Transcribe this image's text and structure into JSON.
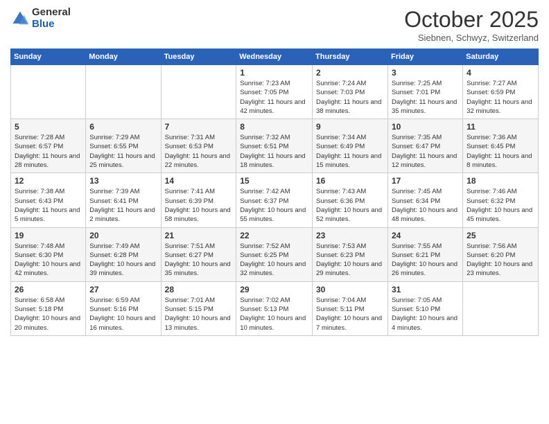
{
  "header": {
    "logo_general": "General",
    "logo_blue": "Blue",
    "month_title": "October 2025",
    "location": "Siebnen, Schwyz, Switzerland"
  },
  "days_of_week": [
    "Sunday",
    "Monday",
    "Tuesday",
    "Wednesday",
    "Thursday",
    "Friday",
    "Saturday"
  ],
  "weeks": [
    [
      {
        "day": "",
        "info": ""
      },
      {
        "day": "",
        "info": ""
      },
      {
        "day": "",
        "info": ""
      },
      {
        "day": "1",
        "info": "Sunrise: 7:23 AM\nSunset: 7:05 PM\nDaylight: 11 hours and 42 minutes."
      },
      {
        "day": "2",
        "info": "Sunrise: 7:24 AM\nSunset: 7:03 PM\nDaylight: 11 hours and 38 minutes."
      },
      {
        "day": "3",
        "info": "Sunrise: 7:25 AM\nSunset: 7:01 PM\nDaylight: 11 hours and 35 minutes."
      },
      {
        "day": "4",
        "info": "Sunrise: 7:27 AM\nSunset: 6:59 PM\nDaylight: 11 hours and 32 minutes."
      }
    ],
    [
      {
        "day": "5",
        "info": "Sunrise: 7:28 AM\nSunset: 6:57 PM\nDaylight: 11 hours and 28 minutes."
      },
      {
        "day": "6",
        "info": "Sunrise: 7:29 AM\nSunset: 6:55 PM\nDaylight: 11 hours and 25 minutes."
      },
      {
        "day": "7",
        "info": "Sunrise: 7:31 AM\nSunset: 6:53 PM\nDaylight: 11 hours and 22 minutes."
      },
      {
        "day": "8",
        "info": "Sunrise: 7:32 AM\nSunset: 6:51 PM\nDaylight: 11 hours and 18 minutes."
      },
      {
        "day": "9",
        "info": "Sunrise: 7:34 AM\nSunset: 6:49 PM\nDaylight: 11 hours and 15 minutes."
      },
      {
        "day": "10",
        "info": "Sunrise: 7:35 AM\nSunset: 6:47 PM\nDaylight: 11 hours and 12 minutes."
      },
      {
        "day": "11",
        "info": "Sunrise: 7:36 AM\nSunset: 6:45 PM\nDaylight: 11 hours and 8 minutes."
      }
    ],
    [
      {
        "day": "12",
        "info": "Sunrise: 7:38 AM\nSunset: 6:43 PM\nDaylight: 11 hours and 5 minutes."
      },
      {
        "day": "13",
        "info": "Sunrise: 7:39 AM\nSunset: 6:41 PM\nDaylight: 11 hours and 2 minutes."
      },
      {
        "day": "14",
        "info": "Sunrise: 7:41 AM\nSunset: 6:39 PM\nDaylight: 10 hours and 58 minutes."
      },
      {
        "day": "15",
        "info": "Sunrise: 7:42 AM\nSunset: 6:37 PM\nDaylight: 10 hours and 55 minutes."
      },
      {
        "day": "16",
        "info": "Sunrise: 7:43 AM\nSunset: 6:36 PM\nDaylight: 10 hours and 52 minutes."
      },
      {
        "day": "17",
        "info": "Sunrise: 7:45 AM\nSunset: 6:34 PM\nDaylight: 10 hours and 48 minutes."
      },
      {
        "day": "18",
        "info": "Sunrise: 7:46 AM\nSunset: 6:32 PM\nDaylight: 10 hours and 45 minutes."
      }
    ],
    [
      {
        "day": "19",
        "info": "Sunrise: 7:48 AM\nSunset: 6:30 PM\nDaylight: 10 hours and 42 minutes."
      },
      {
        "day": "20",
        "info": "Sunrise: 7:49 AM\nSunset: 6:28 PM\nDaylight: 10 hours and 39 minutes."
      },
      {
        "day": "21",
        "info": "Sunrise: 7:51 AM\nSunset: 6:27 PM\nDaylight: 10 hours and 35 minutes."
      },
      {
        "day": "22",
        "info": "Sunrise: 7:52 AM\nSunset: 6:25 PM\nDaylight: 10 hours and 32 minutes."
      },
      {
        "day": "23",
        "info": "Sunrise: 7:53 AM\nSunset: 6:23 PM\nDaylight: 10 hours and 29 minutes."
      },
      {
        "day": "24",
        "info": "Sunrise: 7:55 AM\nSunset: 6:21 PM\nDaylight: 10 hours and 26 minutes."
      },
      {
        "day": "25",
        "info": "Sunrise: 7:56 AM\nSunset: 6:20 PM\nDaylight: 10 hours and 23 minutes."
      }
    ],
    [
      {
        "day": "26",
        "info": "Sunrise: 6:58 AM\nSunset: 5:18 PM\nDaylight: 10 hours and 20 minutes."
      },
      {
        "day": "27",
        "info": "Sunrise: 6:59 AM\nSunset: 5:16 PM\nDaylight: 10 hours and 16 minutes."
      },
      {
        "day": "28",
        "info": "Sunrise: 7:01 AM\nSunset: 5:15 PM\nDaylight: 10 hours and 13 minutes."
      },
      {
        "day": "29",
        "info": "Sunrise: 7:02 AM\nSunset: 5:13 PM\nDaylight: 10 hours and 10 minutes."
      },
      {
        "day": "30",
        "info": "Sunrise: 7:04 AM\nSunset: 5:11 PM\nDaylight: 10 hours and 7 minutes."
      },
      {
        "day": "31",
        "info": "Sunrise: 7:05 AM\nSunset: 5:10 PM\nDaylight: 10 hours and 4 minutes."
      },
      {
        "day": "",
        "info": ""
      }
    ]
  ]
}
